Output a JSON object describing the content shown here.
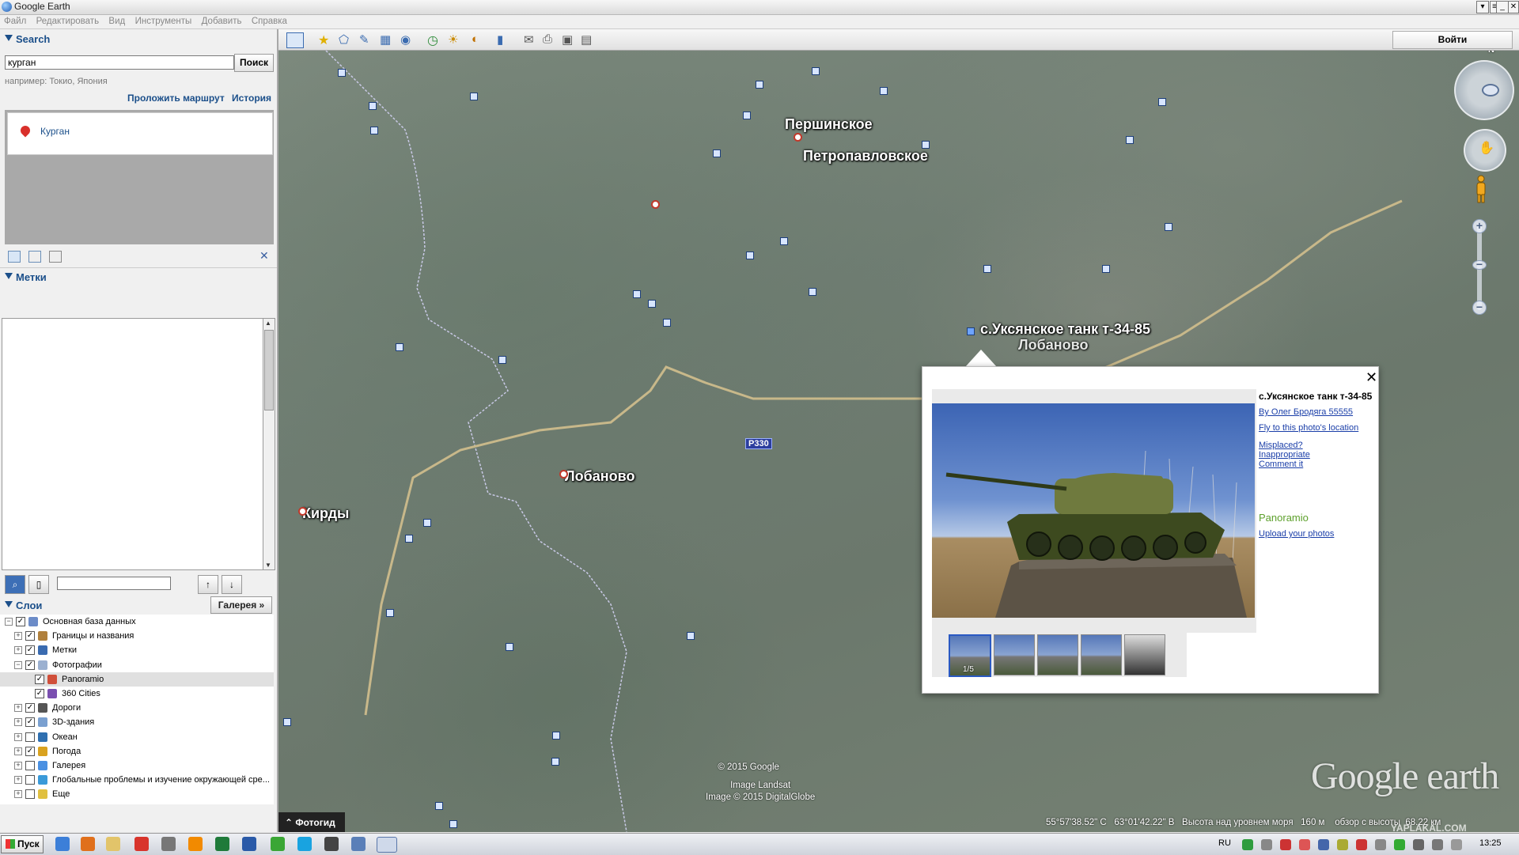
{
  "window": {
    "title": "Google Earth",
    "controls": [
      "minimize",
      "restore",
      "close"
    ]
  },
  "menu": [
    "Файл",
    "Редактировать",
    "Вид",
    "Инструменты",
    "Добавить",
    "Справка"
  ],
  "search_panel": {
    "header": "Search",
    "query": "курган",
    "button": "Поиск",
    "hint": "например: Токио, Япония",
    "route_link": "Проложить маршрут",
    "history_link": "История",
    "result": "Курган"
  },
  "places_panel": {
    "header": "Метки"
  },
  "layers_panel": {
    "header": "Слои",
    "gallery_button": "Галерея",
    "items": [
      {
        "label": "Основная база данных",
        "checked": true,
        "expanded": true,
        "depth": 0
      },
      {
        "label": "Границы и названия",
        "checked": true,
        "expanded": false,
        "depth": 1
      },
      {
        "label": "Метки",
        "checked": true,
        "expanded": false,
        "depth": 1
      },
      {
        "label": "Фотографии",
        "checked": true,
        "expanded": true,
        "depth": 1
      },
      {
        "label": "Panoramio",
        "checked": true,
        "expanded": false,
        "depth": 2
      },
      {
        "label": "360 Cities",
        "checked": true,
        "expanded": false,
        "depth": 2
      },
      {
        "label": "Дороги",
        "checked": true,
        "expanded": false,
        "depth": 1
      },
      {
        "label": "3D-здания",
        "checked": true,
        "expanded": false,
        "depth": 1
      },
      {
        "label": "Океан",
        "checked": false,
        "expanded": false,
        "depth": 1
      },
      {
        "label": "Погода",
        "checked": true,
        "expanded": false,
        "depth": 1
      },
      {
        "label": "Галерея",
        "checked": false,
        "expanded": false,
        "depth": 1
      },
      {
        "label": "Глобальные проблемы и изучение окружающей сре...",
        "checked": false,
        "expanded": false,
        "depth": 1
      },
      {
        "label": "Еще",
        "checked": false,
        "expanded": false,
        "depth": 1
      }
    ]
  },
  "toolbar": {
    "login": "Войти"
  },
  "map": {
    "places": [
      "Першинское",
      "Петропавловское",
      "Лобаново",
      "Кирды",
      "с.Уксянское танк т-34-85",
      "Лобаново"
    ],
    "road": "Р330",
    "compass_n": "N",
    "copyright": [
      "© 2015 Google",
      "Image Landsat",
      "Image © 2015 DigitalGlobe"
    ],
    "logo": "Google earth",
    "fotogid": "Фотогид",
    "status": {
      "lat": "55°57'38.52\" С",
      "lon": "63°01'42.22\" В",
      "elevation_label": "Высота над уровнем моря",
      "elevation": "160 м",
      "eye_label": "обзор с высоты",
      "eye": "68.22 км"
    },
    "watermark": "YAPLAKAL.COM"
  },
  "popup": {
    "title": "с.Уксянское танк т-34-85",
    "author_link": "By Олег Бродяга 55555",
    "fly_link": "Fly to this photo's location",
    "misplaced": "Misplaced?",
    "inappropriate": "Inappropriate",
    "comment": "Comment it",
    "brand": "Panoramio",
    "upload": "Upload your photos",
    "counter": "1/5",
    "thumbnail_count": 5
  },
  "taskbar": {
    "start": "Пуск",
    "lang": "RU",
    "time": "13:25"
  },
  "colors": {
    "accent": "#1b4f8a",
    "link": "#1a3ea8",
    "panoramio": "#5da02c",
    "road_label": "#2c3e9e"
  }
}
